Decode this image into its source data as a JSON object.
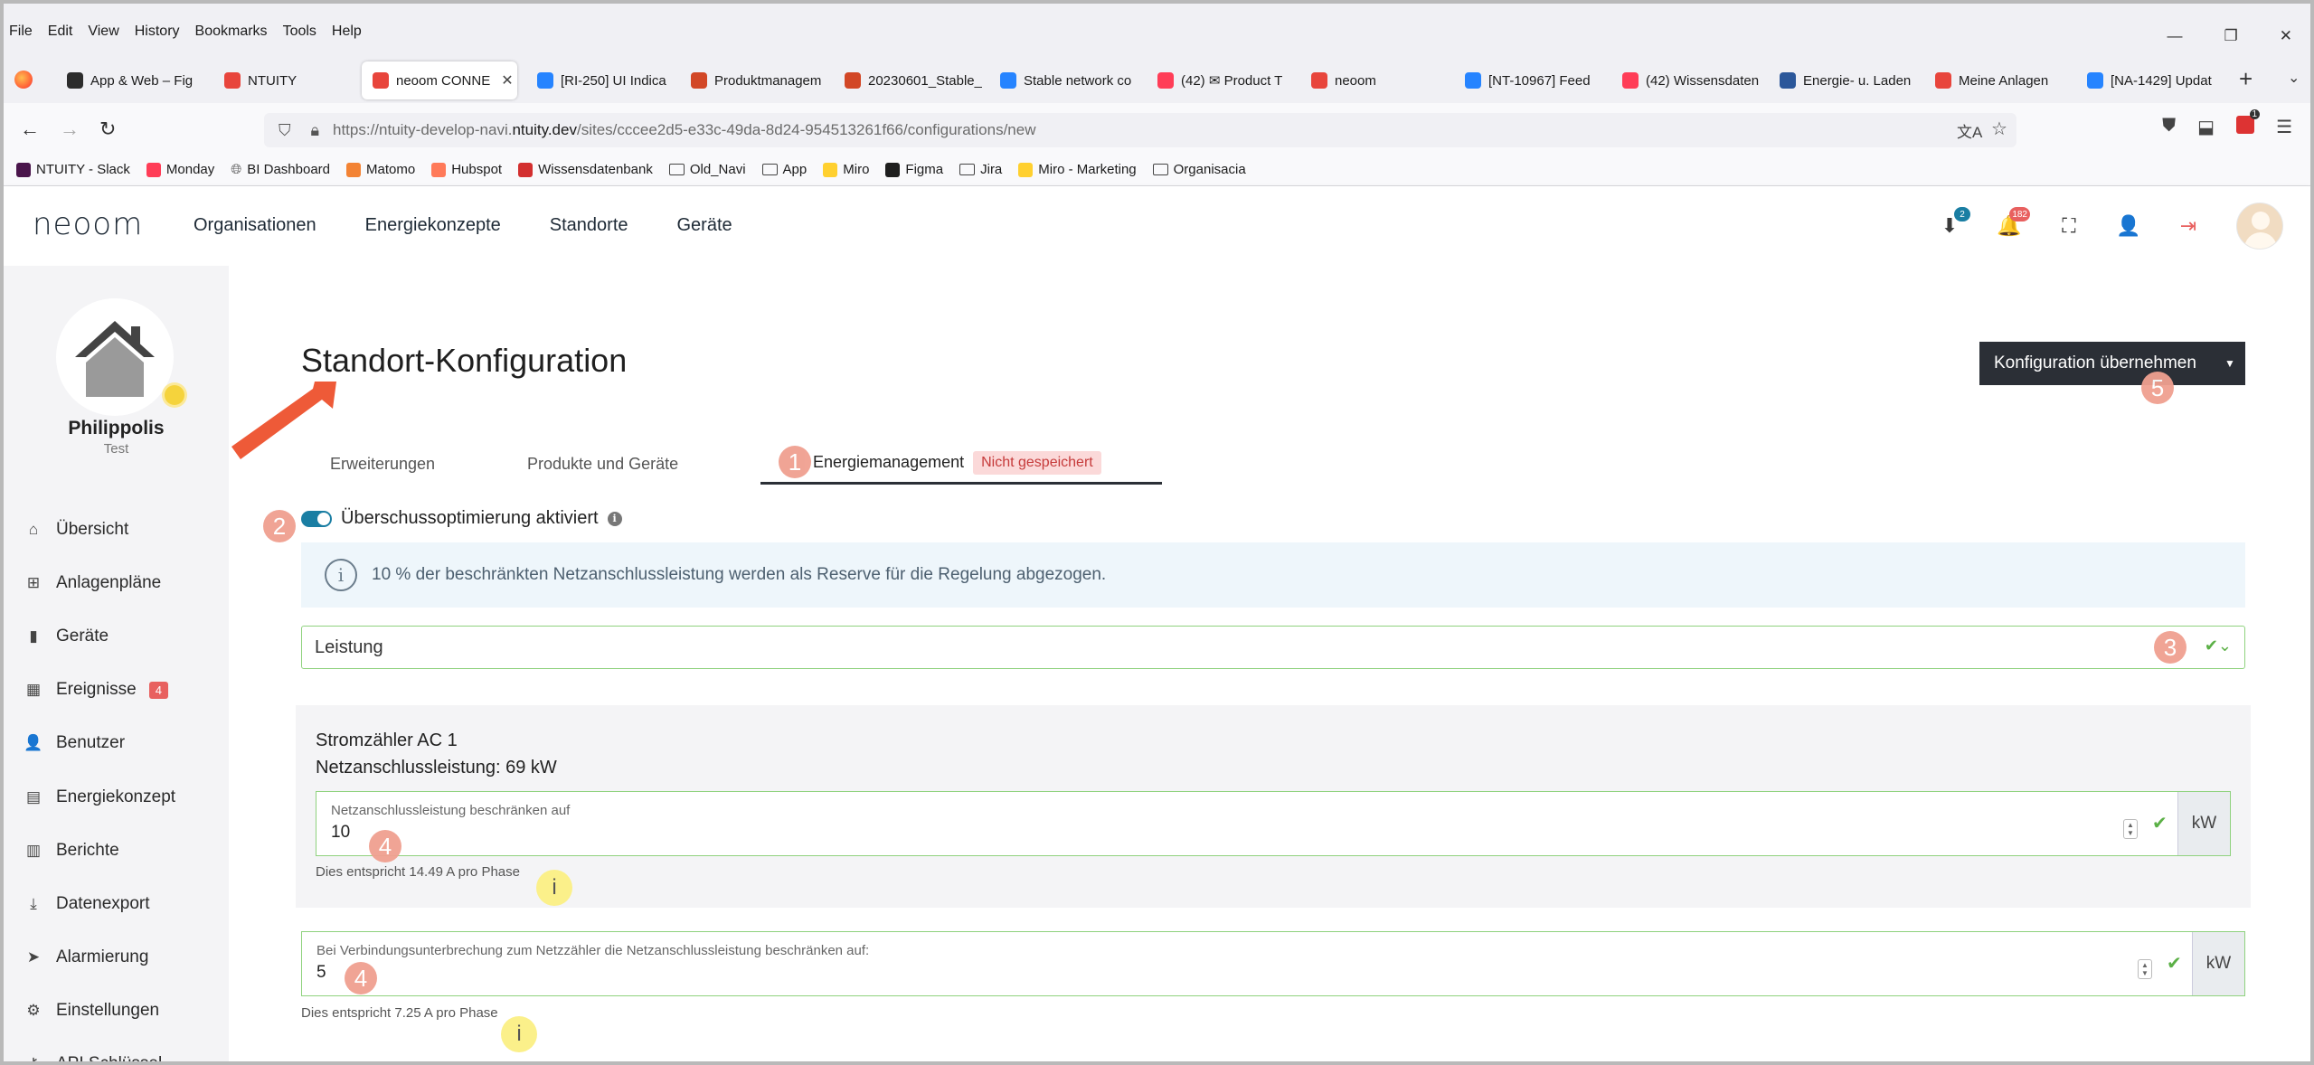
{
  "browser": {
    "menus": [
      "File",
      "Edit",
      "View",
      "History",
      "Bookmarks",
      "Tools",
      "Help"
    ],
    "tabs": [
      {
        "label": "App & Web – Fig",
        "color": "#2c2c2c"
      },
      {
        "label": "NTUITY",
        "color": "#e8453c"
      },
      {
        "label": "neoom CONNE",
        "color": "#e8453c"
      },
      {
        "label": "[RI-250] UI Indica",
        "color": "#2684ff"
      },
      {
        "label": "Produktmanagem",
        "color": "#d24726"
      },
      {
        "label": "20230601_Stable_",
        "color": "#d24726"
      },
      {
        "label": "Stable network co",
        "color": "#2684ff"
      },
      {
        "label": "(42) ✉ Product T",
        "color": "#ff3d57"
      },
      {
        "label": "neoom",
        "color": "#e8453c"
      },
      {
        "label": "[NT-10967] Feed",
        "color": "#2684ff"
      },
      {
        "label": "(42) Wissensdaten",
        "color": "#ff3d57"
      },
      {
        "label": "Energie- u. Laden",
        "color": "#2b579a"
      },
      {
        "label": "Meine Anlagen",
        "color": "#e8453c"
      },
      {
        "label": "[NA-1429] Updat",
        "color": "#2684ff"
      }
    ],
    "url_prefix": "https://ntuity-develop-navi.",
    "url_host": "ntuity.dev",
    "url_path": "/sites/cccee2d5-e33c-49da-8d24-954513261f66/configurations/new",
    "extension_badge": "1",
    "bookmarks": [
      {
        "label": "NTUITY - Slack",
        "kind": "icon",
        "color": "#4a154b"
      },
      {
        "label": "Monday",
        "kind": "icon",
        "color": "#ff3d57"
      },
      {
        "label": "BI Dashboard",
        "kind": "globe",
        "color": "#555555"
      },
      {
        "label": "Matomo",
        "kind": "icon",
        "color": "#f38334"
      },
      {
        "label": "Hubspot",
        "kind": "icon",
        "color": "#ff7a59"
      },
      {
        "label": "Wissensdatenbank",
        "kind": "icon",
        "color": "#d32f2f"
      },
      {
        "label": "Old_Navi",
        "kind": "folder",
        "color": "#444444"
      },
      {
        "label": "App",
        "kind": "folder",
        "color": "#444444"
      },
      {
        "label": "Miro",
        "kind": "icon",
        "color": "#ffd02f"
      },
      {
        "label": "Figma",
        "kind": "icon",
        "color": "#1e1e1e"
      },
      {
        "label": "Jira",
        "kind": "folder",
        "color": "#444444"
      },
      {
        "label": "Miro - Marketing",
        "kind": "icon",
        "color": "#ffd02f"
      },
      {
        "label": "Organisacia",
        "kind": "folder",
        "color": "#444444"
      }
    ]
  },
  "app": {
    "logo": "neoom",
    "nav": [
      "Organisationen",
      "Energiekonzepte",
      "Standorte",
      "Geräte"
    ],
    "header_icons": [
      {
        "name": "download-icon",
        "glyph": "⬇",
        "badge": "2",
        "badge_color": "#1a7ea3"
      },
      {
        "name": "bell-icon",
        "glyph": "🔔",
        "badge": "182",
        "badge_color": "#e8605f"
      },
      {
        "name": "fullscreen-icon",
        "glyph": "⛶",
        "badge": "",
        "badge_color": ""
      },
      {
        "name": "user-secret-icon",
        "glyph": "👤",
        "badge": "",
        "badge_color": ""
      },
      {
        "name": "logout-icon",
        "glyph": "⇥",
        "badge": "",
        "badge_color": ""
      }
    ],
    "colors": {
      "accent": "#1a7ea3",
      "danger": "#e8605f",
      "valid": "#8fd27e",
      "dark": "#2b2f36"
    }
  },
  "sidebar": {
    "site_name": "Philippolis",
    "site_sub": "Test",
    "items": [
      {
        "label": "Übersicht",
        "icon": "home-icon",
        "glyph": "⌂",
        "badge": ""
      },
      {
        "label": "Anlagenpläne",
        "icon": "sitemap-icon",
        "glyph": "⊞",
        "badge": ""
      },
      {
        "label": "Geräte",
        "icon": "device-icon",
        "glyph": "▮",
        "badge": ""
      },
      {
        "label": "Ereignisse",
        "icon": "calendar-icon",
        "glyph": "▦",
        "badge": "4"
      },
      {
        "label": "Benutzer",
        "icon": "user-icon",
        "glyph": "👤",
        "badge": ""
      },
      {
        "label": "Energiekonzept",
        "icon": "document-icon",
        "glyph": "▤",
        "badge": ""
      },
      {
        "label": "Berichte",
        "icon": "chart-icon",
        "glyph": "▥",
        "badge": ""
      },
      {
        "label": "Datenexport",
        "icon": "export-icon",
        "glyph": "⤓",
        "badge": ""
      },
      {
        "label": "Alarmierung",
        "icon": "paper-plane-icon",
        "glyph": "➤",
        "badge": ""
      },
      {
        "label": "Einstellungen",
        "icon": "gear-icon",
        "glyph": "⚙",
        "badge": ""
      },
      {
        "label": "API Schlüssel",
        "icon": "key-icon",
        "glyph": "⚷",
        "badge": ""
      }
    ]
  },
  "main": {
    "title": "Standort-Konfiguration",
    "apply_button": "Konfiguration übernehmen",
    "tabs": [
      "Erweiterungen",
      "Produkte und Geräte",
      "Energiemanagement"
    ],
    "unsaved_badge": "Nicht gespeichert",
    "toggle_label": "Überschussoptimierung aktiviert",
    "toggle_on": true,
    "info_text": "10 % der beschränkten Netzanschlussleistung werden als Reserve für die Regelung abgezogen.",
    "select_value": "Leistung",
    "meter": {
      "name": "Stromzähler AC 1",
      "capacity": "Netzanschlussleistung: 69 kW",
      "limit_label": "Netzanschlussleistung beschränken auf",
      "limit_value": "10",
      "limit_unit": "kW",
      "limit_hint": "Dies entspricht 14.49 A pro Phase"
    },
    "fallback": {
      "label": "Bei Verbindungsunterbrechung zum Netzzähler die Netzanschlussleistung beschränken auf:",
      "value": "5",
      "unit": "kW",
      "hint": "Dies entspricht 7.25 A pro Phase"
    }
  },
  "annotations": {
    "steps": [
      "1",
      "2",
      "3",
      "4",
      "4",
      "5"
    ],
    "info_marks": [
      "i",
      "i"
    ]
  }
}
